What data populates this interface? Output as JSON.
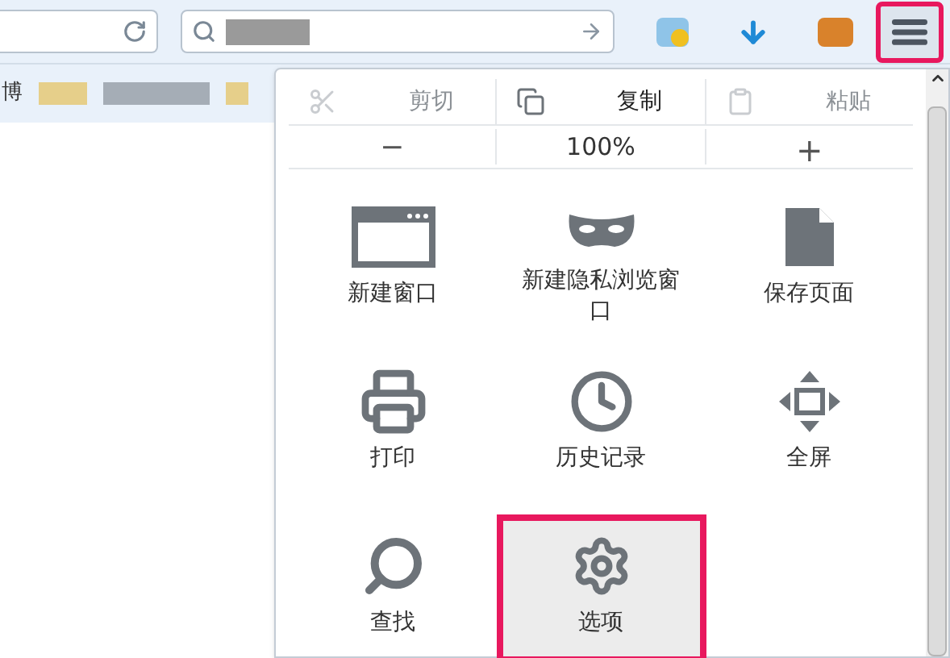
{
  "toolbar": {
    "menu_button": {
      "highlighted": true
    }
  },
  "bookmarks_bar": {
    "items": [
      {
        "label": "博"
      }
    ]
  },
  "menu": {
    "edit_row": [
      {
        "kind": "cut",
        "label": "剪切",
        "disabled": true
      },
      {
        "kind": "copy",
        "label": "复制",
        "disabled": false
      },
      {
        "kind": "paste",
        "label": "粘贴",
        "disabled": true
      }
    ],
    "zoom_row": {
      "decrease": "−",
      "level_text": "100%",
      "increase": "+"
    },
    "items": [
      {
        "kind": "window",
        "label": "新建窗口",
        "highlighted": false
      },
      {
        "kind": "private",
        "label": "新建隐私浏览窗口",
        "highlighted": false
      },
      {
        "kind": "save",
        "label": "保存页面",
        "highlighted": false
      },
      {
        "kind": "print",
        "label": "打印",
        "highlighted": false
      },
      {
        "kind": "history",
        "label": "历史记录",
        "highlighted": false
      },
      {
        "kind": "fullscreen",
        "label": "全屏",
        "highlighted": false
      },
      {
        "kind": "find",
        "label": "查找",
        "highlighted": false
      },
      {
        "kind": "options",
        "label": "选项",
        "highlighted": true
      }
    ]
  }
}
